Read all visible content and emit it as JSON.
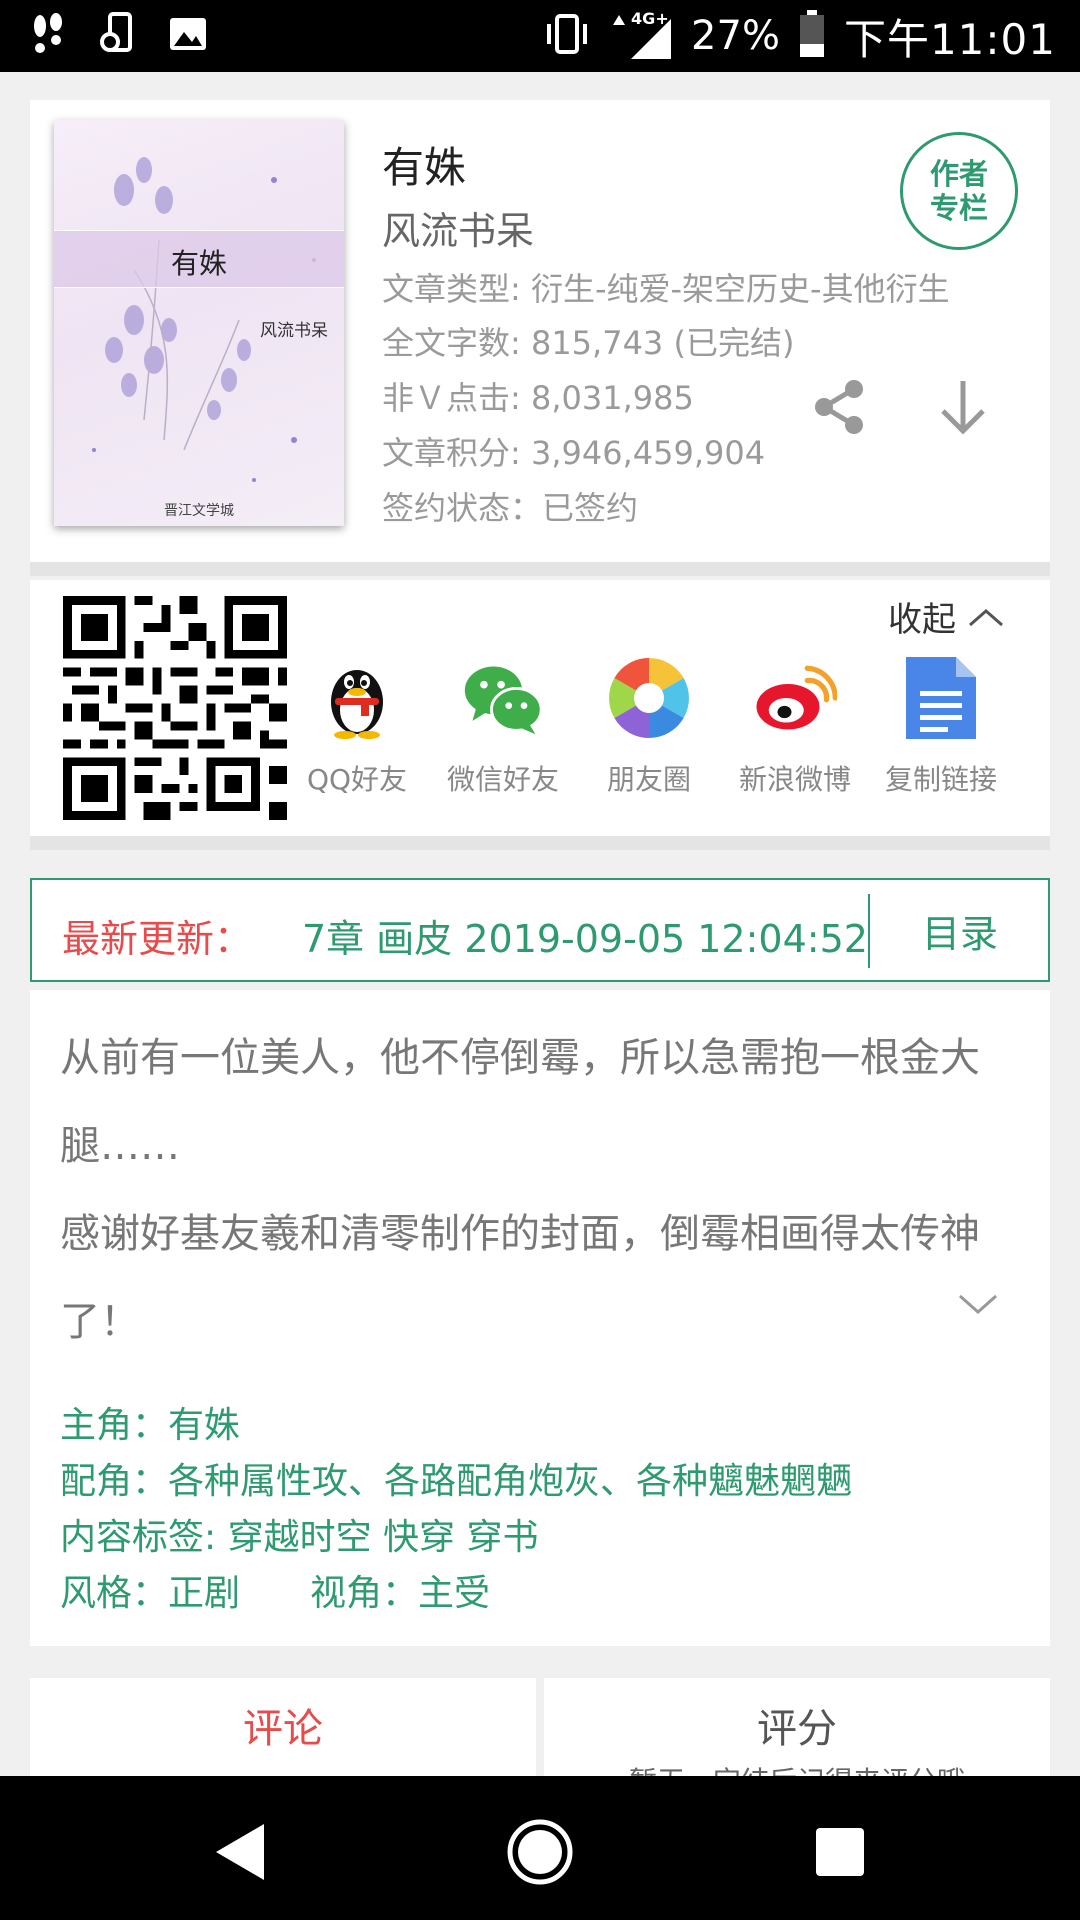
{
  "status_bar": {
    "left_icons": [
      "footsteps-icon",
      "sync-phone-icon",
      "image-icon"
    ],
    "network": "4G+",
    "battery": "27%",
    "time": "下午11:01"
  },
  "book": {
    "cover": {
      "title": "有姝",
      "author": "风流书呆",
      "publisher": "晋江文学城"
    },
    "title": "有姝",
    "author": "风流书呆",
    "author_badge": [
      "作者",
      "专栏"
    ],
    "meta": [
      "文章类型: 衍生-纯爱-架空历史-其他衍生",
      "全文字数: 815,743 (已完结)",
      "非Ｖ点击: 8,031,985",
      "文章积分: 3,946,459,904",
      "签约状态：已签约"
    ]
  },
  "share": {
    "collapse_label": "收起",
    "items": [
      {
        "label": "QQ好友",
        "icon": "qq-penguin-icon"
      },
      {
        "label": "微信好友",
        "icon": "wechat-icon"
      },
      {
        "label": "朋友圈",
        "icon": "moments-aperture-icon"
      },
      {
        "label": "新浪微博",
        "icon": "weibo-icon"
      },
      {
        "label": "复制链接",
        "icon": "document-icon"
      }
    ]
  },
  "update": {
    "label": "最新更新：",
    "text": "7章  画皮  2019-09-05 12:04:52",
    "catalog": "目录"
  },
  "description": {
    "line1": "从前有一位美人，他不停倒霉，所以急需抱一根金大腿……",
    "line2": "感谢好基友羲和清零制作的封面，倒霉相画得太传神了！"
  },
  "tags": {
    "protagonist": "主角：有姝",
    "supporting": "配角：各种属性攻、各路配角炮灰、各种魑魅魍魉",
    "content_tags": "内容标签: 穿越时空 快穿 穿书",
    "style": "风格：正剧",
    "perspective": "视角：主受"
  },
  "tabs": {
    "comment": "评论",
    "rating": "评分",
    "rating_sub": "暂无，完结后记得来评分哦"
  },
  "colors": {
    "accent_green": "#2e9a6f",
    "accent_red": "#e84b4b"
  }
}
